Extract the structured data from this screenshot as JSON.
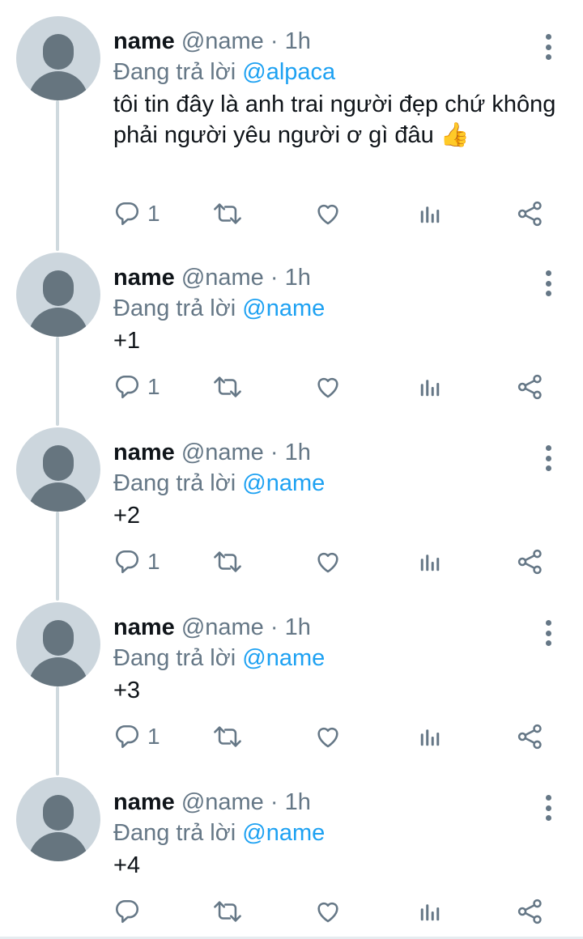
{
  "tweets": [
    {
      "name": "name",
      "handle": "@name",
      "sep": "·",
      "time": "1h",
      "reply_prefix": "Đang trả lời",
      "mention": "@alpaca",
      "text": "tôi tin đây là anh trai người đẹp chứ không phải người yêu người ơ gì đâu 👍",
      "reply_count": "1"
    },
    {
      "name": "name",
      "handle": "@name",
      "sep": "·",
      "time": "1h",
      "reply_prefix": "Đang trả lời",
      "mention": "@name",
      "text": "+1",
      "reply_count": "1"
    },
    {
      "name": "name",
      "handle": "@name",
      "sep": "·",
      "time": "1h",
      "reply_prefix": "Đang trả lời",
      "mention": "@name",
      "text": "+2",
      "reply_count": "1"
    },
    {
      "name": "name",
      "handle": "@name",
      "sep": "·",
      "time": "1h",
      "reply_prefix": "Đang trả lời",
      "mention": "@name",
      "text": "+3",
      "reply_count": "1"
    },
    {
      "name": "name",
      "handle": "@name",
      "sep": "·",
      "time": "1h",
      "reply_prefix": "Đang trả lời",
      "mention": "@name",
      "text": "+4",
      "reply_count": ""
    }
  ],
  "icons": {
    "reply": "reply-icon",
    "retweet": "retweet-icon",
    "like": "heart-icon",
    "analytics": "analytics-icon",
    "share": "share-icon",
    "more": "more-vertical-icon"
  },
  "colors": {
    "text": "#0f1419",
    "secondary": "#657786",
    "mention": "#1da1f2",
    "avatar_bg": "#ccd6dd",
    "thread_line": "#cfd9de"
  }
}
